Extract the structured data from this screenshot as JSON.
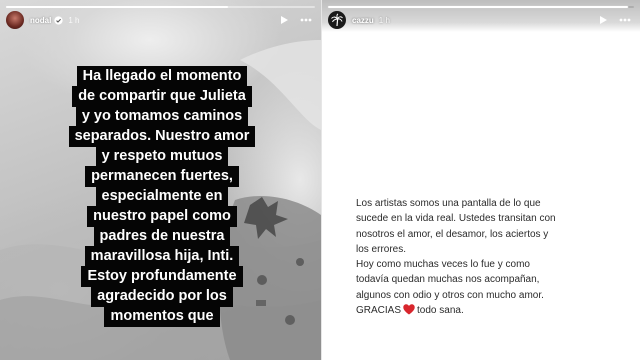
{
  "left_story": {
    "username": "nodal",
    "time": "1 h",
    "progress": 0.72,
    "caption_lines": [
      "Ha llegado el momento",
      "de compartir que Julieta",
      "y yo tomamos caminos",
      "separados. Nuestro amor",
      "y respeto mutuos",
      "permanecen fuertes,",
      "especialmente en",
      "nuestro papel como",
      "padres de nuestra",
      "maravillosa hija, Inti.",
      "Estoy profundamente",
      "agradecido por los",
      "momentos que"
    ],
    "icons": {
      "play": "play-icon",
      "more": "more-dots-icon",
      "verified": "verified-badge-icon"
    }
  },
  "right_story": {
    "username": "cazzu",
    "time": "1 h",
    "progress": 0.98,
    "text_lines": [
      "Los artistas somos una pantalla de lo que",
      "sucede en la vida real. Ustedes transitan con",
      "nosotros el amor, el desamor, los aciertos y",
      "los errores.",
      "Hoy como muchas veces lo fue y como",
      "todavía quedan muchas nos acompañan,",
      "algunos con odio y otros con mucho amor."
    ],
    "last_line_start": "GRACIAS",
    "last_line_end": "todo sana.",
    "heart_color": "#d8262d",
    "icons": {
      "play": "play-icon",
      "more": "more-dots-icon",
      "avatar": "palm-tree-icon"
    }
  }
}
